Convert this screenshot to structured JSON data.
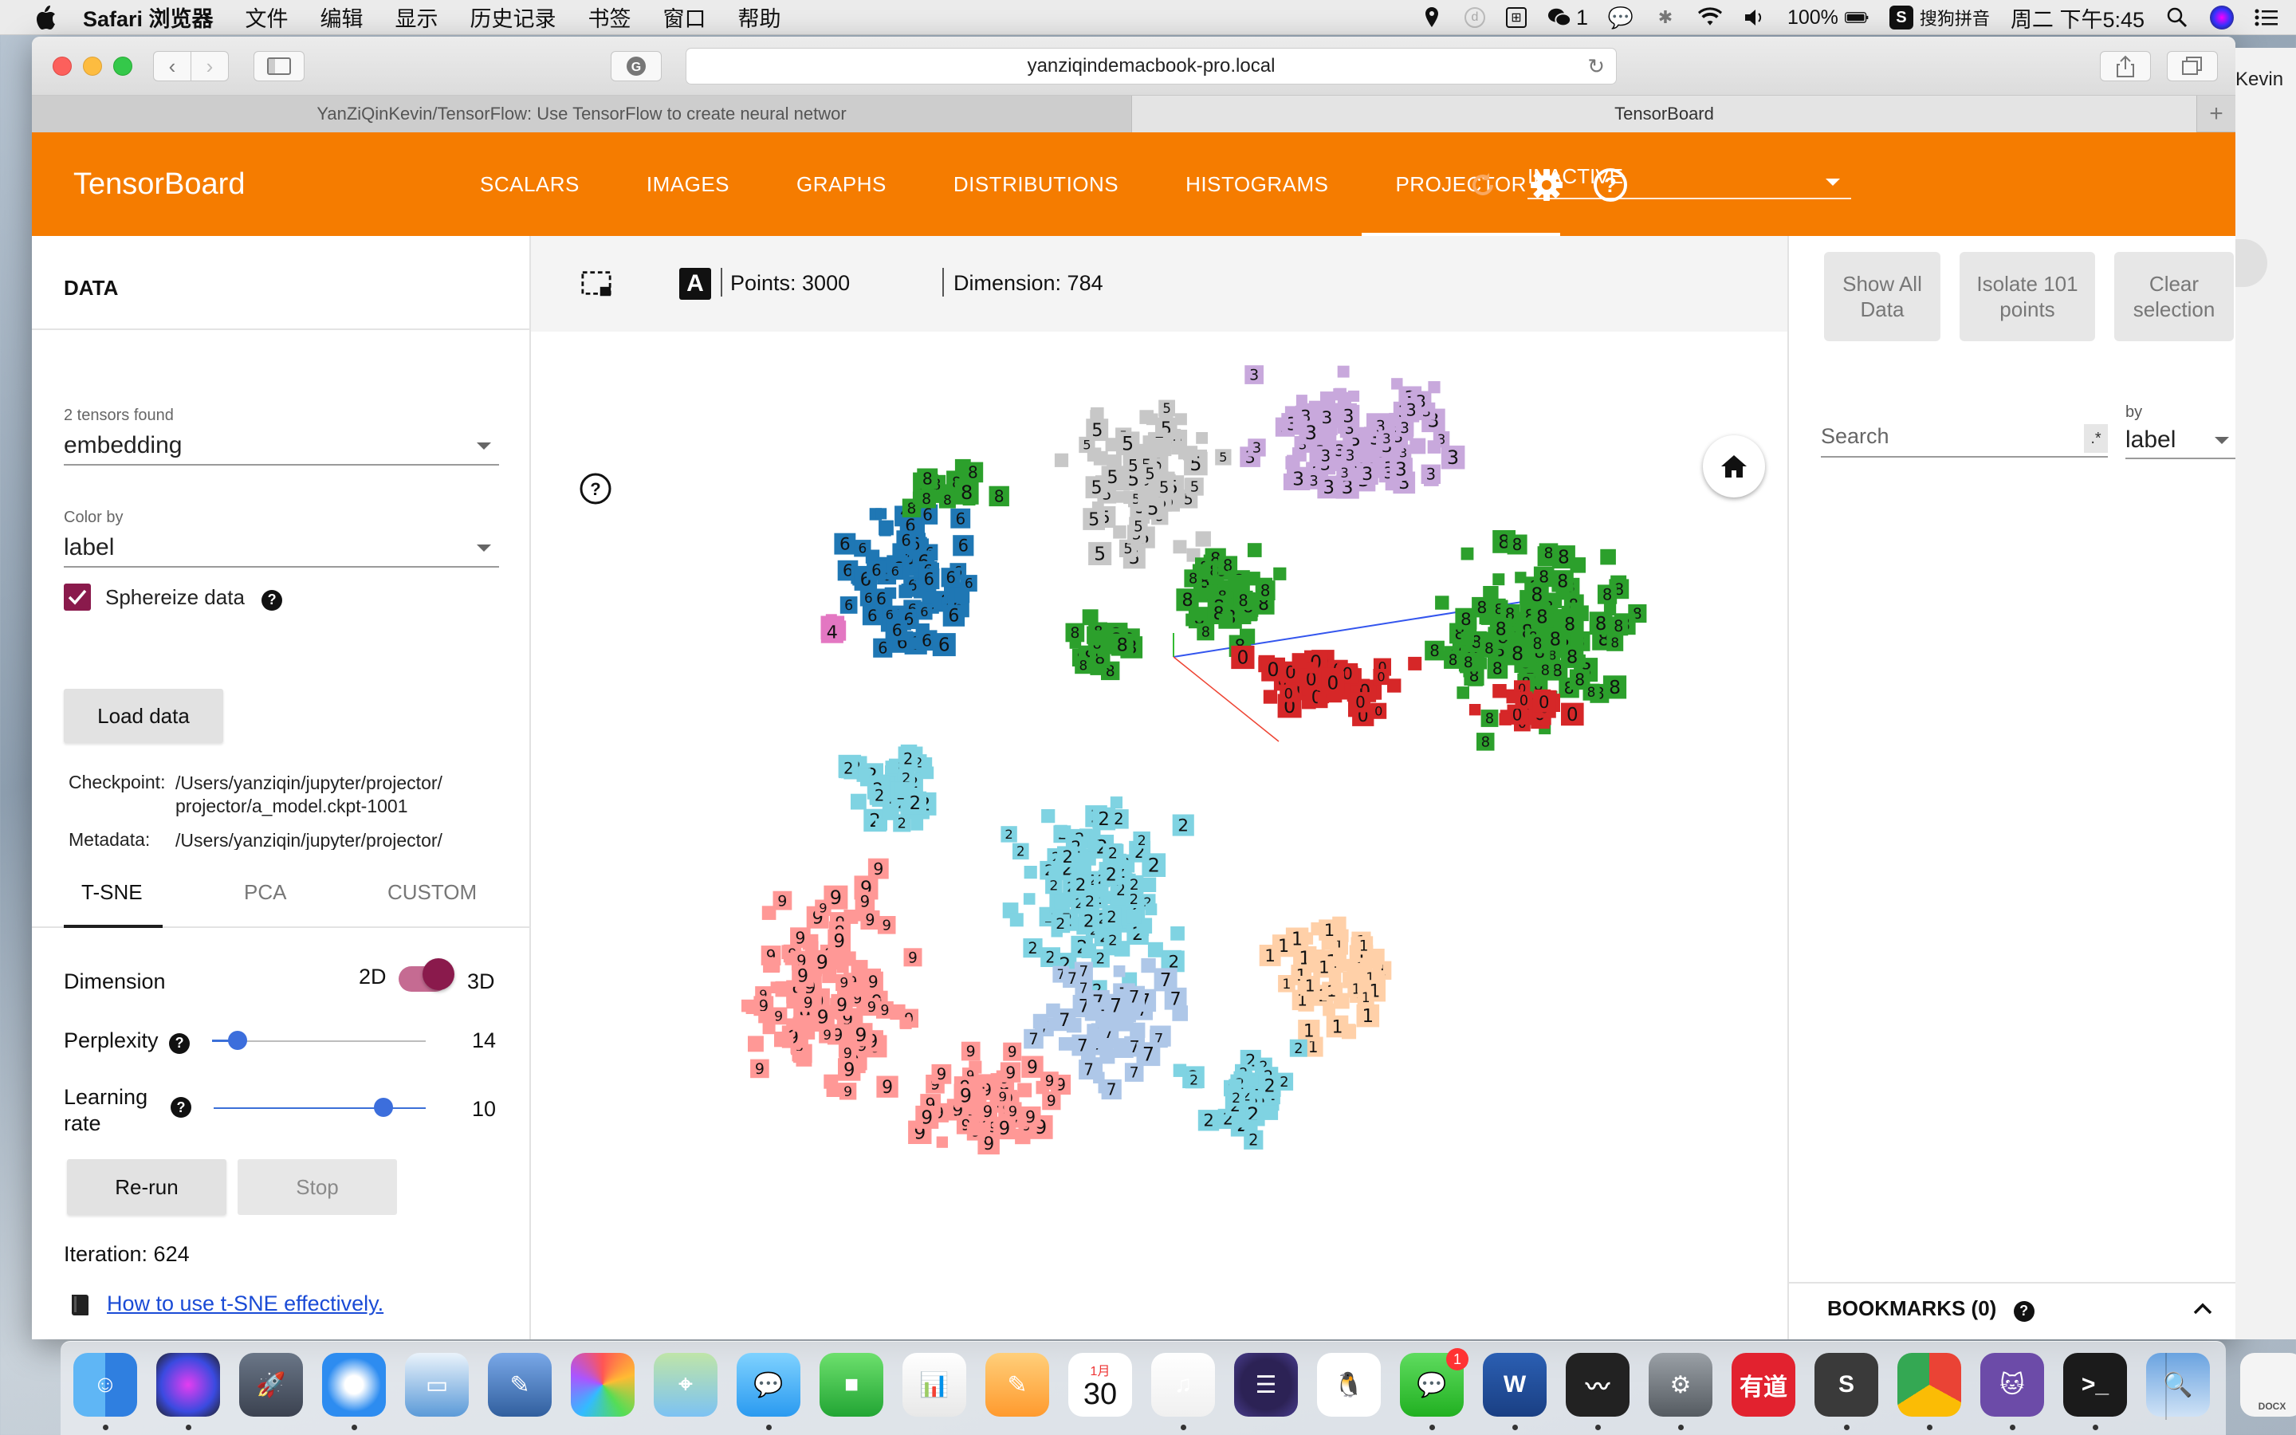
{
  "menubar": {
    "app_name": "Safari 浏览器",
    "items": [
      "文件",
      "编辑",
      "显示",
      "历史记录",
      "书签",
      "窗口",
      "帮助"
    ],
    "wechat_count": "1",
    "battery": "100%",
    "input_method": "搜狗拼音",
    "datetime": "周二 下午5:45"
  },
  "browser": {
    "url": "yanziqindemacbook-pro.local",
    "tabs": [
      {
        "label": "YanZiQinKevin/TensorFlow: Use TensorFlow to create neural networ"
      },
      {
        "label": "TensorBoard"
      }
    ],
    "profile_name": "Kevin"
  },
  "header": {
    "title": "TensorBoard",
    "nav": [
      "SCALARS",
      "IMAGES",
      "GRAPHS",
      "DISTRIBUTIONS",
      "HISTOGRAMS",
      "PROJECTOR"
    ],
    "selected_nav": "PROJECTOR",
    "run_select": "INACTIVE"
  },
  "left": {
    "data_title": "DATA",
    "tensors_found_label": "2 tensors found",
    "tensor_value": "embedding",
    "color_by_label": "Color by",
    "color_by_value": "label",
    "sphereize_label": "Sphereize data",
    "sphereize_checked": true,
    "load_data_label": "Load data",
    "checkpoint_key": "Checkpoint:",
    "checkpoint_line1": "/Users/yanziqin/jupyter/projector/",
    "checkpoint_line2": "projector/a_model.ckpt-1001",
    "metadata_key": "Metadata:",
    "metadata_line1": "/Users/yanziqin/jupyter/projector/",
    "method_tabs": [
      "T-SNE",
      "PCA",
      "CUSTOM"
    ],
    "selected_method": "T-SNE",
    "dimension_label": "Dimension",
    "dim_2d": "2D",
    "dim_3d": "3D",
    "dimension_value": "3D",
    "perplexity_label": "Perplexity",
    "perplexity_value": "14",
    "perplexity_fraction": 0.12,
    "learning_rate_label_1": "Learning",
    "learning_rate_label_2": "rate",
    "learning_rate_value": "10",
    "learning_rate_fraction": 0.8,
    "rerun_label": "Re-run",
    "stop_label": "Stop",
    "iteration_text": "Iteration: 624",
    "help_link": "How to use t-SNE effectively."
  },
  "center": {
    "points_text": "Points: 3000",
    "dimension_text": "Dimension: 784",
    "night_mode_icon": "moon-icon",
    "label_icon": "A",
    "clusters": [
      {
        "label": "3",
        "color": "#c8a8dc"
      },
      {
        "label": "5",
        "color": "#c7c7c7"
      },
      {
        "label": "8",
        "color": "#2ca02c"
      },
      {
        "label": "6",
        "color": "#1f77b4"
      },
      {
        "label": "2",
        "color": "#7fd3e2"
      },
      {
        "label": "4",
        "color": "#e377c2"
      },
      {
        "label": "9",
        "color": "#ff9896"
      },
      {
        "label": "7",
        "color": "#aec7e8"
      },
      {
        "label": "1",
        "color": "#ffd0a8"
      },
      {
        "label": "0",
        "color": "#d62728"
      }
    ]
  },
  "right": {
    "show_all_line1": "Show All",
    "show_all_line2": "Data",
    "isolate_line1": "Isolate 101",
    "isolate_line2": "points",
    "clear_line1": "Clear",
    "clear_line2": "selection",
    "search_placeholder": "Search",
    "regex_label": ".*",
    "by_label": "by",
    "by_value": "label",
    "bookmarks_title": "BOOKMARKS (0)"
  },
  "dock": {
    "calendar_month": "1月",
    "calendar_day": "30",
    "wechat_badge": "1",
    "youdao_label": "有道",
    "docx_label": "DOCX",
    "apps": [
      "Finder",
      "Siri",
      "Launchpad",
      "Safari",
      "Keynote",
      "Preview",
      "Photos",
      "Maps",
      "Messages",
      "FaceTime",
      "Numbers",
      "Pages",
      "Calendar",
      "Music",
      "Eclipse",
      "QQ",
      "WeChat",
      "Word",
      "Activity Monitor",
      "System Preferences",
      "Youdao",
      "Sublime Text",
      "Chrome",
      "GitHub",
      "Terminal",
      "Preview Image",
      "Document",
      "Trash"
    ]
  }
}
